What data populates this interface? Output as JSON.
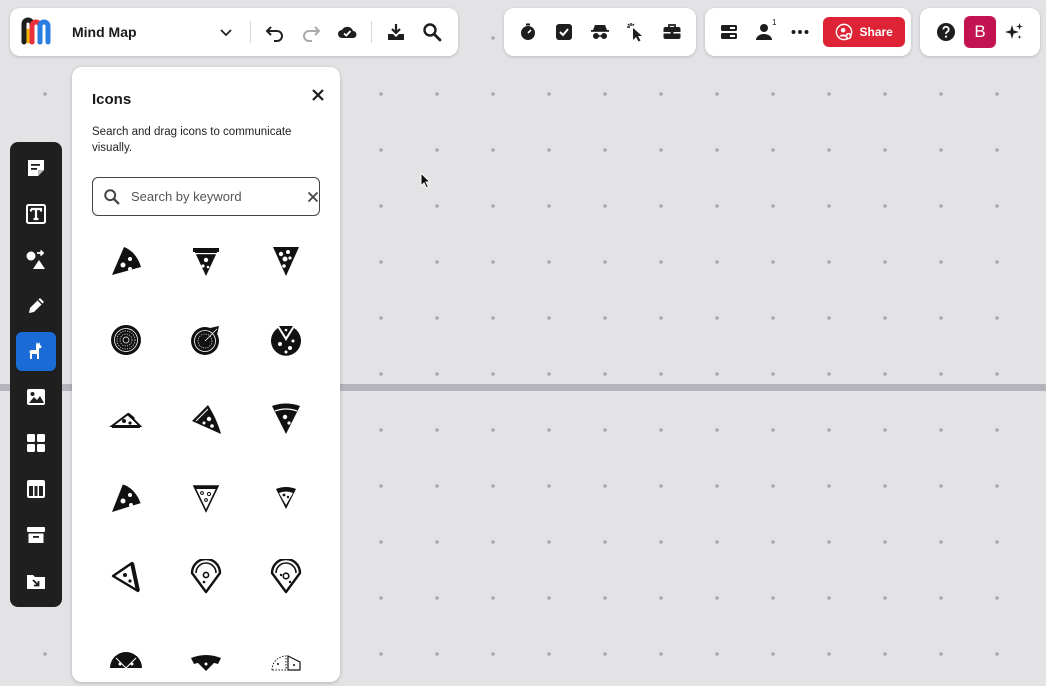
{
  "header": {
    "board_title": "Mind Map",
    "share_label": "Share",
    "collaborator_count": "1",
    "avatar_initial": "B"
  },
  "toolbar_icons": [
    "undo-icon",
    "redo-icon",
    "cloud-check-icon",
    "download-icon",
    "search-icon"
  ],
  "tools_icons": [
    "timer-icon",
    "checkbox-icon",
    "incognito-icon",
    "cursor-click-icon",
    "toolbox-icon"
  ],
  "collab_icons": [
    "board-settings-icon",
    "user-icon",
    "more-icon"
  ],
  "left_toolbar": [
    "sticky-note-icon",
    "text-icon",
    "shapes-icon",
    "pen-icon",
    "icons-llama-icon",
    "image-icon",
    "templates-icon",
    "table-icon",
    "archive-icon",
    "import-icon"
  ],
  "panel": {
    "title": "Icons",
    "description": "Search and drag icons to communicate visually.",
    "search_placeholder": "Search by keyword",
    "icons": [
      "pizza-slice-icon",
      "pizza-slice-icon",
      "pizza-slice-icon",
      "pizza-icon",
      "pizza-icon",
      "pizza-icon",
      "pizza-slice-icon",
      "pizza-slice-icon",
      "pizza-slice-icon",
      "pizza-slice-icon",
      "pizza-slice-icon",
      "pizza-slice-icon",
      "pizza-slice-icon",
      "pizza-slice-icon",
      "pizza-slice-icon",
      "pizza-icon",
      "pizza-icon",
      "pizza-icon"
    ]
  },
  "colors": {
    "accent": "#1b6bd6",
    "share": "#dd2335",
    "avatar": "#c21450",
    "canvas": "#e3e3e5"
  }
}
